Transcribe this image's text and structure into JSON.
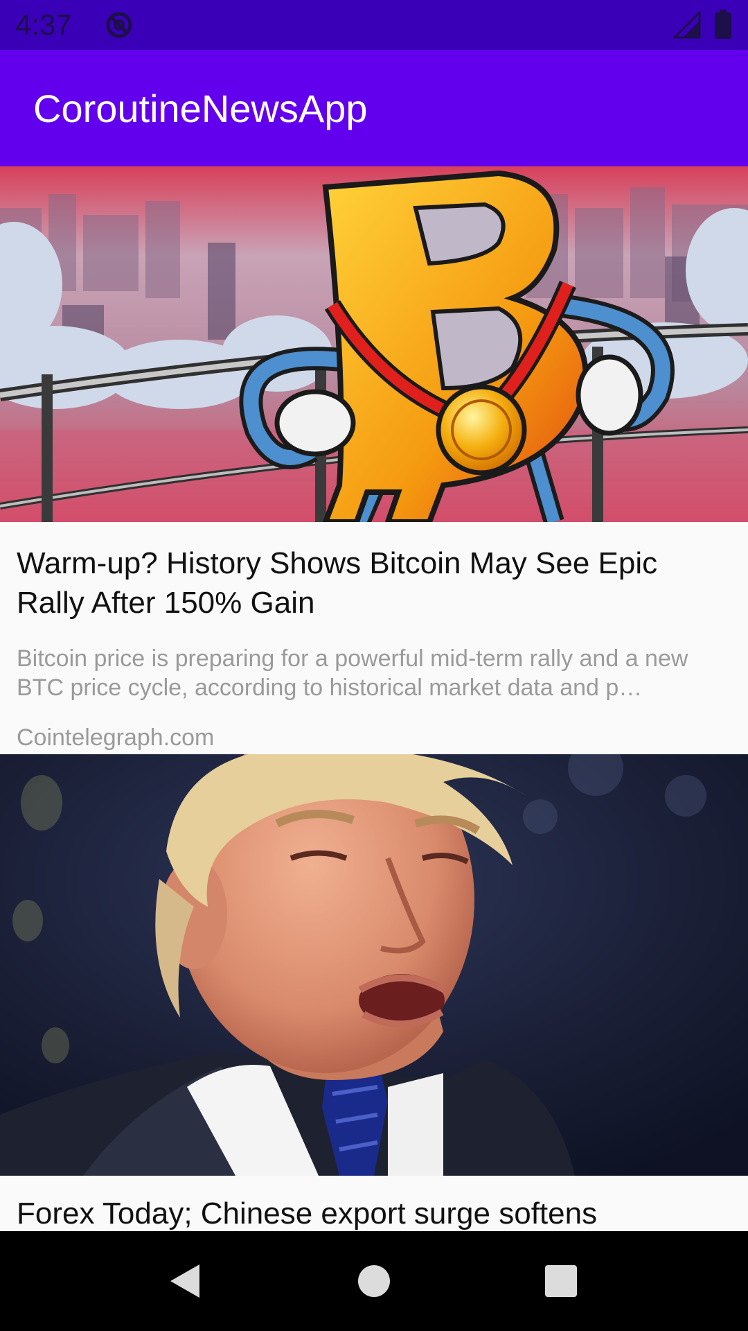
{
  "status_bar": {
    "time": "4:37",
    "icons": [
      "do-not-disturb-icon",
      "cell-signal-icon",
      "battery-icon"
    ],
    "background": "#3a00b8"
  },
  "app_bar": {
    "title": "CoroutineNewsApp",
    "background": "#6200ee"
  },
  "articles": [
    {
      "image": "bitcoin-mascot-illustration",
      "title": "Warm-up? History Shows Bitcoin May See Epic Rally After 150% Gain",
      "description": "Bitcoin price is preparing for a powerful mid-term rally and a new BTC price cycle, according to historical market data and p…",
      "source": "Cointelegraph.com"
    },
    {
      "image": "speaker-portrait-photo",
      "title": "Forex Today; Chinese export surge softens"
    }
  ],
  "nav_bar": {
    "buttons": [
      "back-icon",
      "home-icon",
      "recents-icon"
    ]
  }
}
